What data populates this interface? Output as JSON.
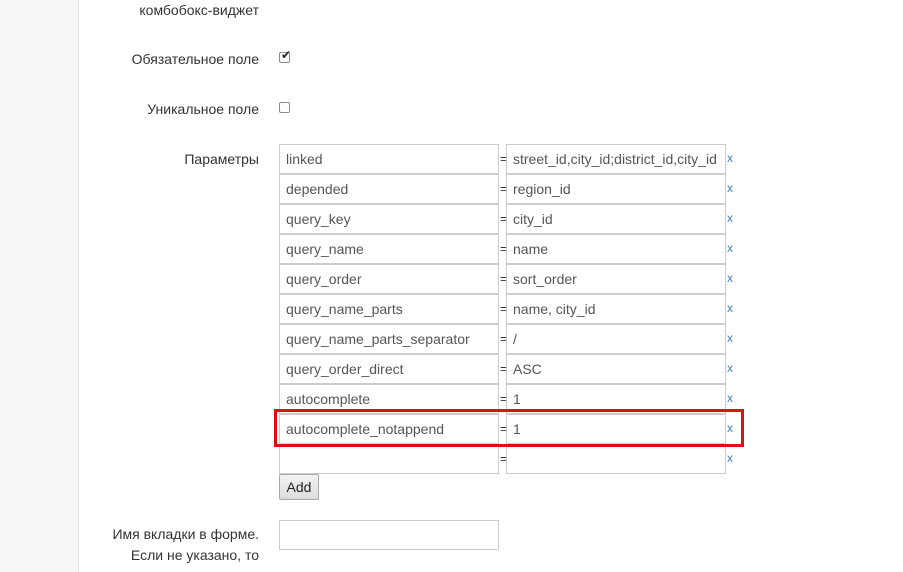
{
  "form": {
    "widget_label_tail": "комбобокс-виджет",
    "required_label": "Обязательное поле",
    "required_checked": true,
    "unique_label": "Уникальное поле",
    "unique_checked": false,
    "params_label": "Параметры",
    "equals_sign": "=",
    "remove_label": "x",
    "params": [
      {
        "key": "linked",
        "value": "street_id,city_id;district_id,city_id"
      },
      {
        "key": "depended",
        "value": "region_id"
      },
      {
        "key": "query_key",
        "value": "city_id"
      },
      {
        "key": "query_name",
        "value": "name"
      },
      {
        "key": "query_order",
        "value": "sort_order"
      },
      {
        "key": "query_name_parts",
        "value": "name, city_id"
      },
      {
        "key": "query_name_parts_separator",
        "value": "/"
      },
      {
        "key": "query_order_direct",
        "value": "ASC"
      },
      {
        "key": "autocomplete",
        "value": "1"
      },
      {
        "key": "autocomplete_notappend",
        "value": "1"
      },
      {
        "key": "",
        "value": ""
      }
    ],
    "add_button": "Add",
    "tab_name_label_line1": "Имя вкладки в форме.",
    "tab_name_label_line2": "Если не указано, то",
    "tab_name_value": ""
  },
  "colors": {
    "highlight_border": "#e01010",
    "link": "#3a7fc4"
  }
}
